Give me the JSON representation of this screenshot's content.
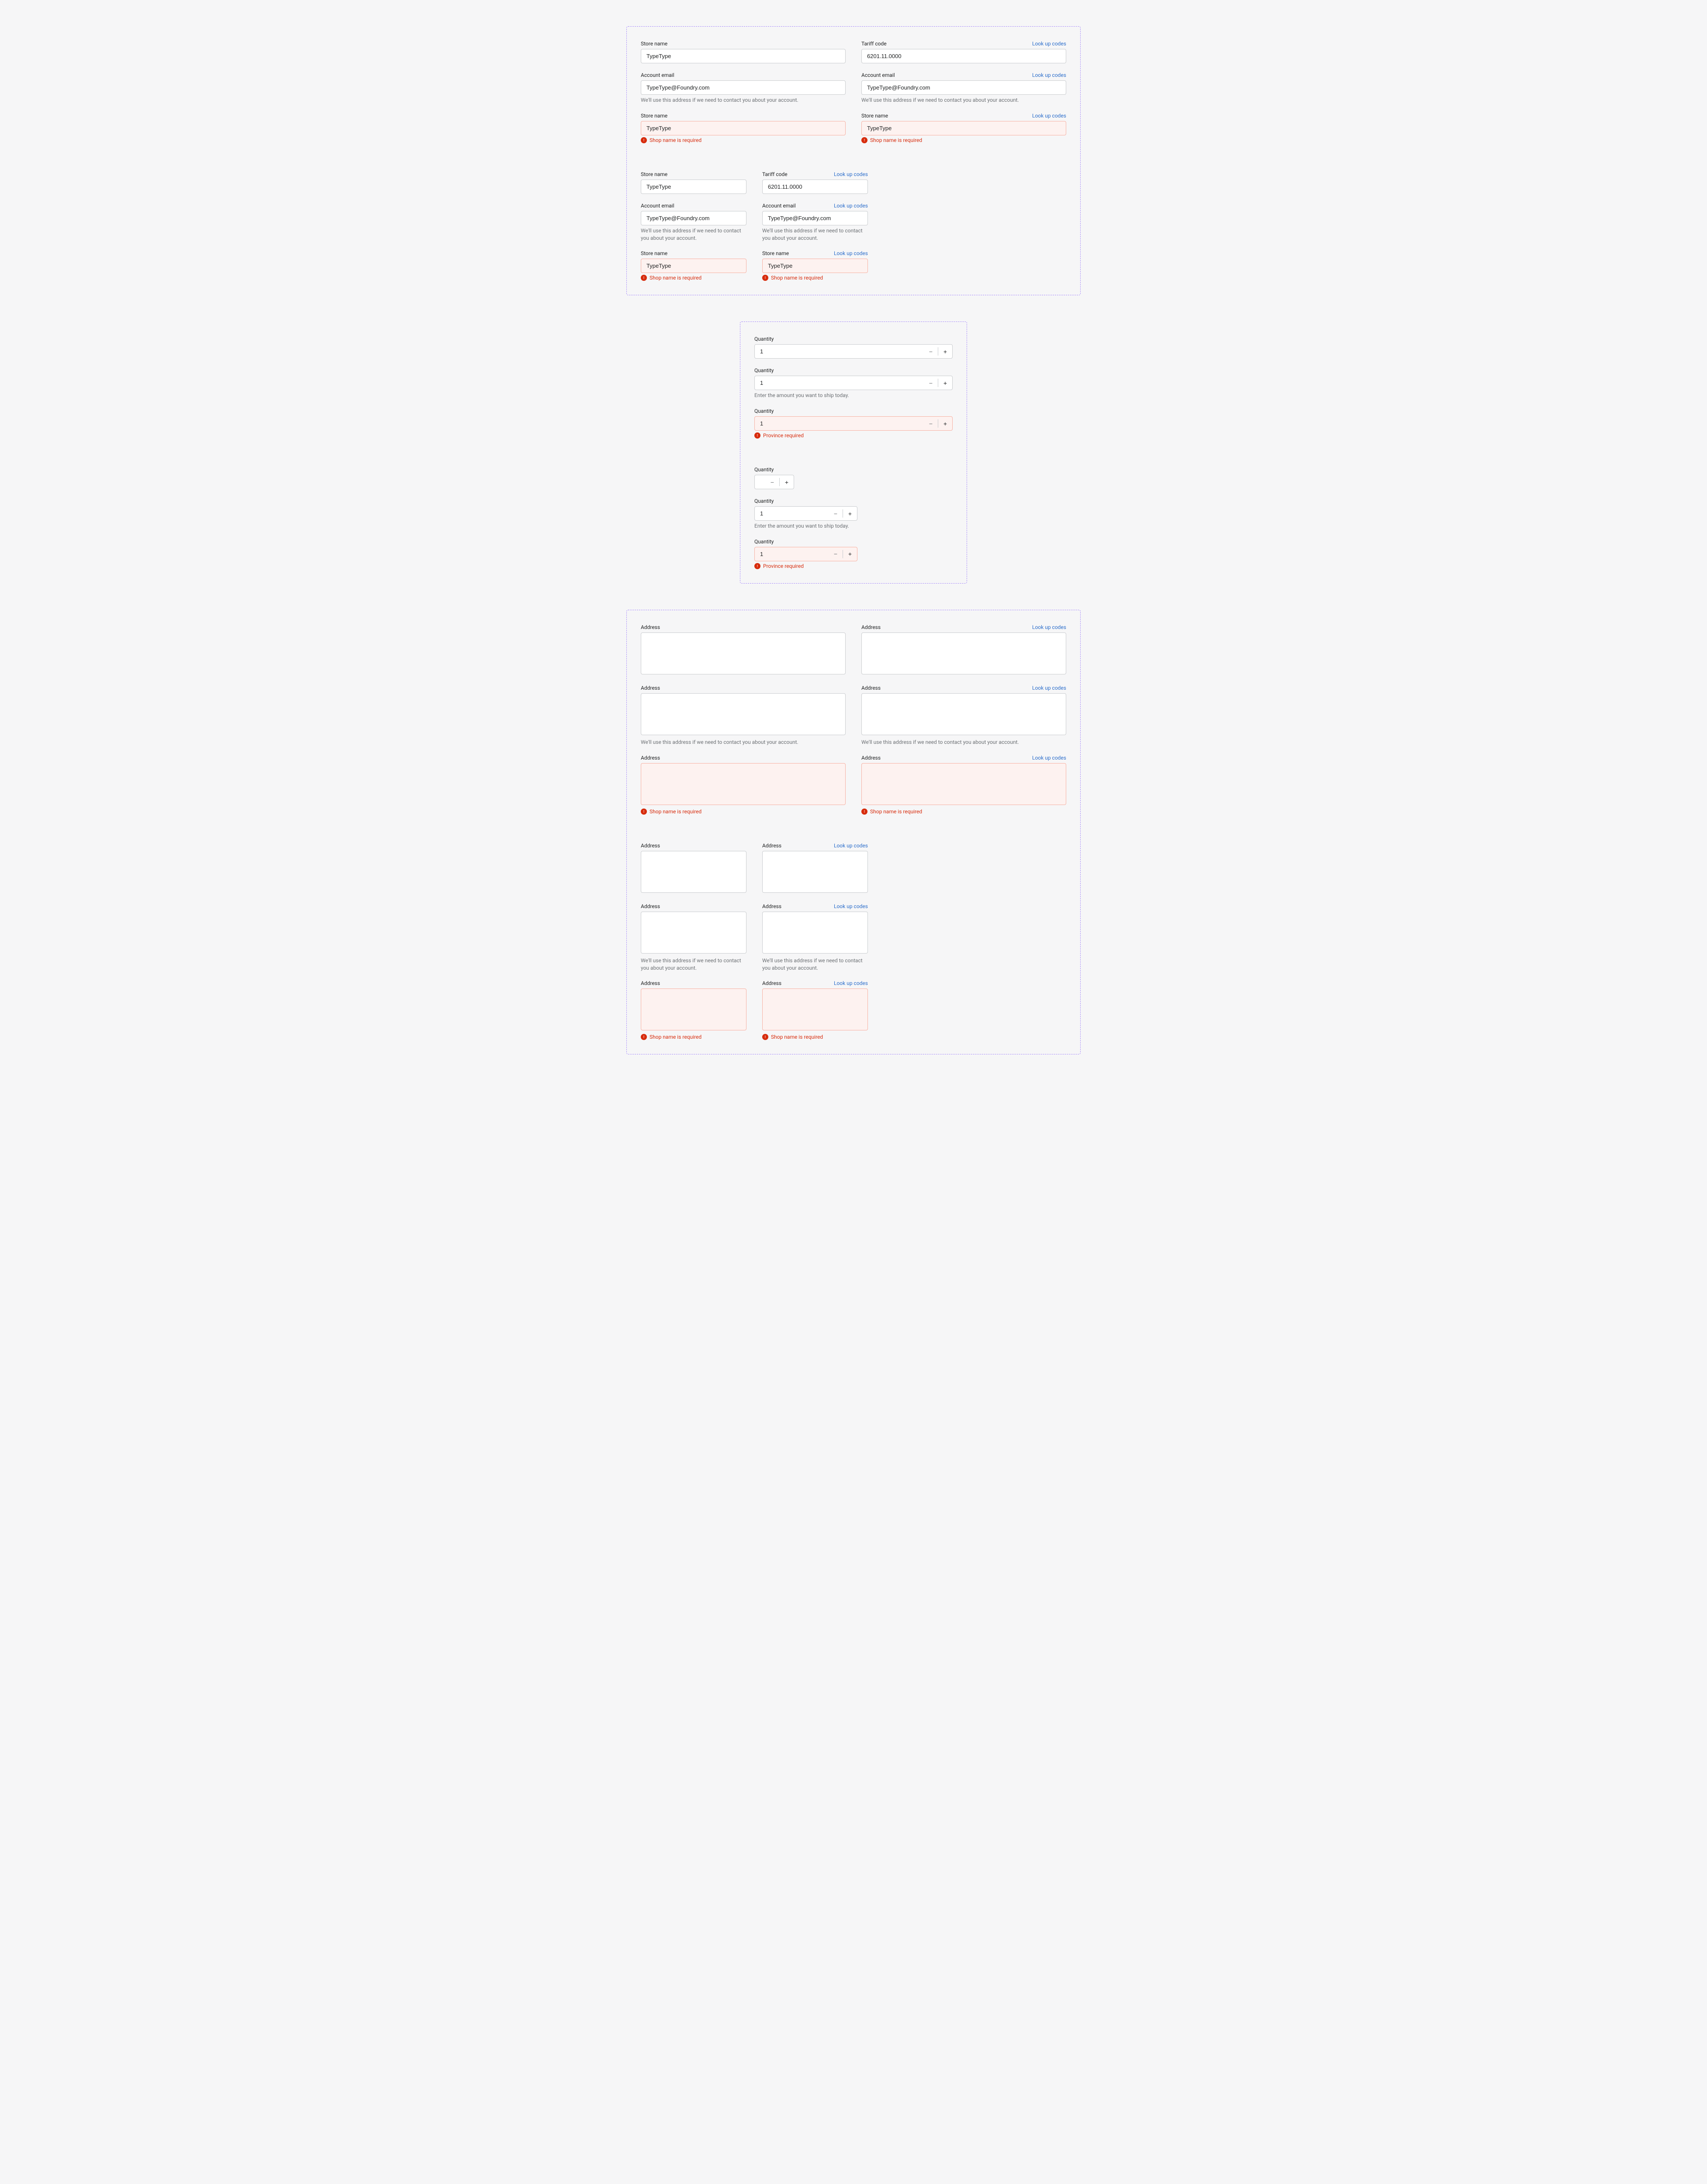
{
  "labels": {
    "store_name": "Store name",
    "tariff_code": "Tariff code",
    "account_email": "Account email",
    "quantity": "Quantity",
    "address": "Address",
    "look_up": "Look up codes"
  },
  "values": {
    "store_name": "TypeType",
    "tariff_code": "6201.11.0000",
    "account_email": "TypeType@Foundry.com",
    "quantity": "1"
  },
  "help": {
    "account_email": "We'll use this address if we need to contact you about your account.",
    "quantity": "Enter the amount you want to ship today."
  },
  "errors": {
    "shop_name": "Shop name is required",
    "province": "Province required"
  },
  "glyphs": {
    "minus": "−",
    "plus": "+"
  }
}
